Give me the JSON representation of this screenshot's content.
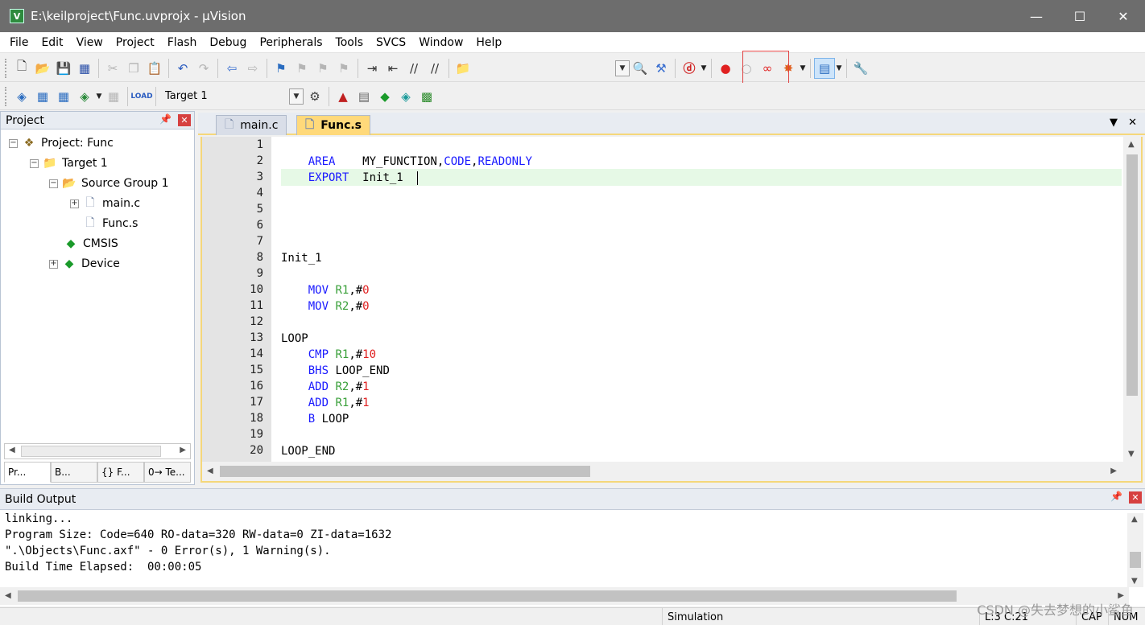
{
  "window": {
    "title": "E:\\keilproject\\Func.uvprojx - µVision",
    "minimize": "—",
    "maximize": "☐",
    "close": "✕"
  },
  "menu": [
    "File",
    "Edit",
    "View",
    "Project",
    "Flash",
    "Debug",
    "Peripherals",
    "Tools",
    "SVCS",
    "Window",
    "Help"
  ],
  "toolbar2": {
    "target": "Target 1"
  },
  "project_panel": {
    "title": "Project",
    "tree": {
      "project": "Project: Func",
      "target": "Target 1",
      "group": "Source Group 1",
      "file1": "main.c",
      "file2": "Func.s",
      "cmsis": "CMSIS",
      "device": "Device"
    },
    "tabs": [
      "Pr...",
      "B...",
      "{} F...",
      "0→ Te..."
    ]
  },
  "editor": {
    "tabs": [
      "main.c",
      "Func.s"
    ],
    "active_tab": "Func.s",
    "line_numbers": [
      "1",
      "2",
      "3",
      "4",
      "5",
      "6",
      "7",
      "8",
      "9",
      "10",
      "11",
      "12",
      "13",
      "14",
      "15",
      "16",
      "17",
      "18",
      "19",
      "20"
    ],
    "code": {
      "l2_kw": "AREA",
      "l2_rest": "    MY_FUNCTION,",
      "l2_p1": "CODE",
      "l2_c": ",",
      "l2_p2": "READONLY",
      "l3_kw": "EXPORT",
      "l3_rest": "  Init_1  ",
      "l8": "Init_1",
      "l10_op": "MOV",
      "l10_r": "R1",
      "l10_c": ",#",
      "l10_n": "0",
      "l11_op": "MOV",
      "l11_r": "R2",
      "l11_c": ",#",
      "l11_n": "0",
      "l13": "LOOP",
      "l14_op": "CMP",
      "l14_r": "R1",
      "l14_c": ",#",
      "l14_n": "10",
      "l15_op": "BHS",
      "l15_rest": " LOOP_END",
      "l16_op": "ADD",
      "l16_r": "R2",
      "l16_c": ",#",
      "l16_n": "1",
      "l17_op": "ADD",
      "l17_r": "R1",
      "l17_c": ",#",
      "l17_n": "1",
      "l18_op": "B",
      "l18_rest": " LOOP",
      "l20": "LOOP_END"
    }
  },
  "build_output": {
    "title": "Build Output",
    "lines": [
      "linking...",
      "Program Size: Code=640 RO-data=320 RW-data=0 ZI-data=1632",
      "\".\\Objects\\Func.axf\" - 0 Error(s), 1 Warning(s).",
      "Build Time Elapsed:  00:00:05"
    ]
  },
  "status_bar": {
    "mode": "Simulation",
    "position": "L:3 C:21",
    "caps": "CAP",
    "num": "NUM"
  },
  "watermark": "CSDN @失去梦想的小鲨鱼"
}
